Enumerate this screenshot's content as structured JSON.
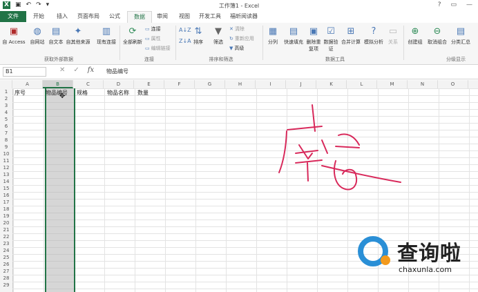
{
  "window": {
    "title": "工作簿1 - Excel"
  },
  "quick_access": {
    "logo": "X",
    "save": "▣",
    "undo": "↶",
    "redo": "↷",
    "more": "▾"
  },
  "window_buttons": {
    "help": "?",
    "restore": "▭",
    "minimize": "—"
  },
  "tabs": [
    "文件",
    "开始",
    "插入",
    "页面布局",
    "公式",
    "数据",
    "审阅",
    "视图",
    "开发工具",
    "福昕阅读器"
  ],
  "active_tab": "数据",
  "ribbon": {
    "external": {
      "access": "自 Access",
      "web": "自网站",
      "text": "自文本",
      "other": "自其他来源",
      "existing": "现有连接",
      "group": "获取外部数据"
    },
    "connections": {
      "refresh_all": "全部刷新",
      "conn": "连接",
      "props": "属性",
      "edit_links": "编辑链接",
      "group": "连接"
    },
    "sort_filter": {
      "sort": "排序",
      "filter": "筛选",
      "clear": "清除",
      "reapply": "重新应用",
      "advanced": "高级",
      "group": "排序和筛选"
    },
    "data_tools": {
      "split": "分列",
      "flash_fill": "快速填充",
      "remove_dup": "删除重复项",
      "validate": "数据验证",
      "consolidate": "合并计算",
      "whatif": "模拟分析",
      "relations": "关系",
      "group": "数据工具"
    },
    "outline": {
      "group_btn": "创建组",
      "ungroup": "取消组合",
      "subtotal": "分类汇总",
      "group": "分级显示"
    }
  },
  "formula_bar": {
    "name_box": "B1",
    "fx": "fx",
    "cancel": "✕",
    "enter": "✓",
    "value": "物品编号"
  },
  "columns": [
    "A",
    "B",
    "C",
    "D",
    "E",
    "F",
    "G",
    "H",
    "I",
    "J",
    "K",
    "L",
    "M",
    "N",
    "O"
  ],
  "selected_column": "B",
  "rows": [
    "1",
    "2",
    "3",
    "4",
    "5",
    "6",
    "7",
    "8",
    "9",
    "10",
    "11",
    "12",
    "13",
    "14",
    "15",
    "16",
    "17",
    "18",
    "19",
    "20",
    "21",
    "22",
    "23",
    "24",
    "25",
    "26",
    "27",
    "28",
    "29"
  ],
  "cells": {
    "A1": "序号",
    "B1": "物品编号",
    "C1": "规格",
    "D1": "物品名称",
    "E1": "数量"
  },
  "watermark": {
    "brand": "查询啦",
    "url": "chaxunla.com"
  },
  "colors": {
    "excel_green": "#217346",
    "ink": "#d8285a",
    "wm_blue": "#2a8fd6",
    "wm_orange": "#f39a1d"
  }
}
